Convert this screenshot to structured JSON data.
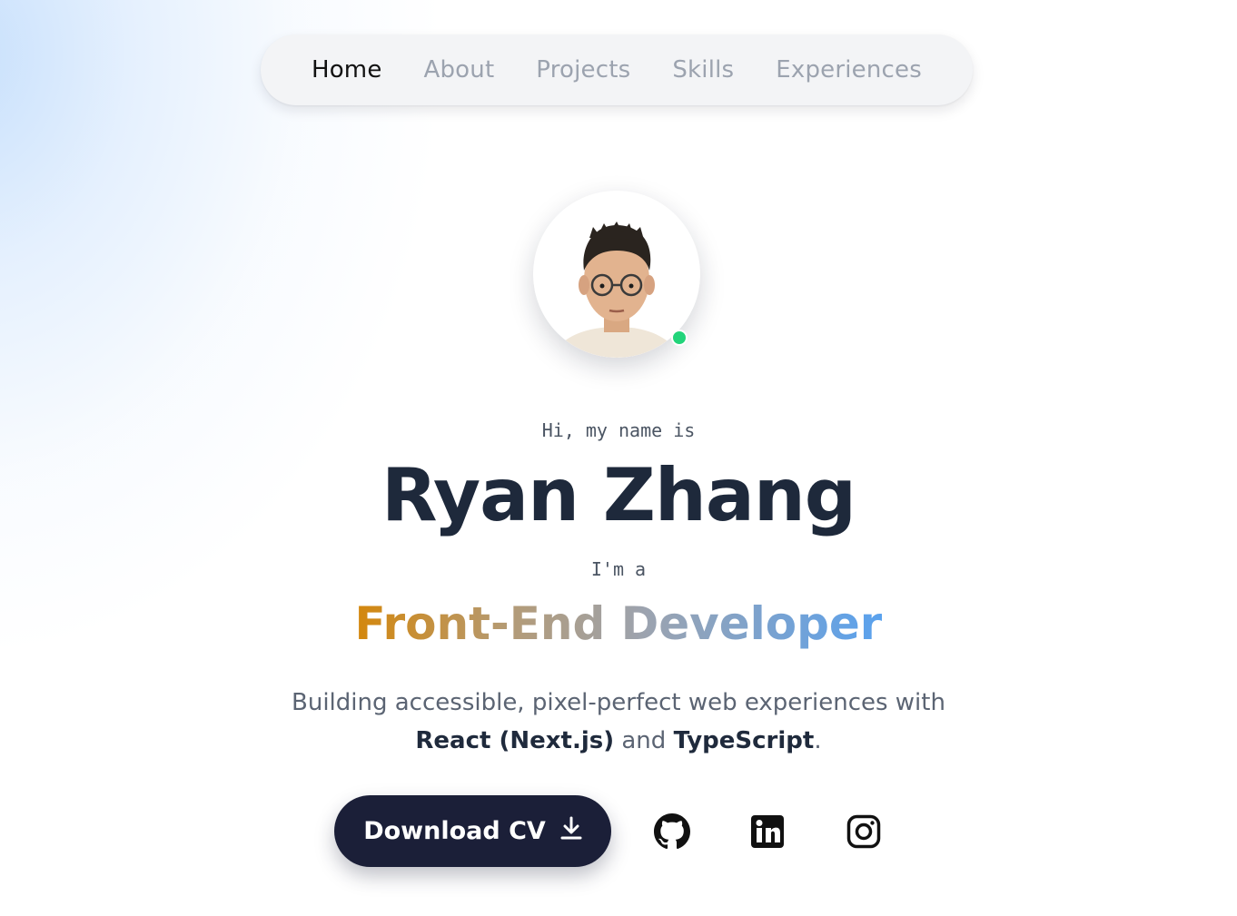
{
  "nav": {
    "items": [
      {
        "label": "Home",
        "active": true
      },
      {
        "label": "About",
        "active": false
      },
      {
        "label": "Projects",
        "active": false
      },
      {
        "label": "Skills",
        "active": false
      },
      {
        "label": "Experiences",
        "active": false
      }
    ]
  },
  "hero": {
    "greeting": "Hi, my name is",
    "name": "Ryan Zhang",
    "intro": "I'm a",
    "role": "Front-End Developer",
    "description": {
      "line1": "Building accessible, pixel-perfect web experiences with",
      "tech1": "React (Next.js)",
      "connector": "and",
      "tech2": "TypeScript",
      "end": "."
    }
  },
  "actions": {
    "download_label": "Download CV",
    "download_icon": "download-icon"
  },
  "social": [
    "github-icon",
    "linkedin-icon",
    "instagram-icon"
  ],
  "status": {
    "online": true,
    "color": "#22d47a"
  },
  "colors": {
    "text_dark": "#1e293b",
    "muted": "#9ca3af",
    "button_bg": "#1b1f38",
    "gradient_start": "#d4870c",
    "gradient_end": "#5aa2ee"
  }
}
